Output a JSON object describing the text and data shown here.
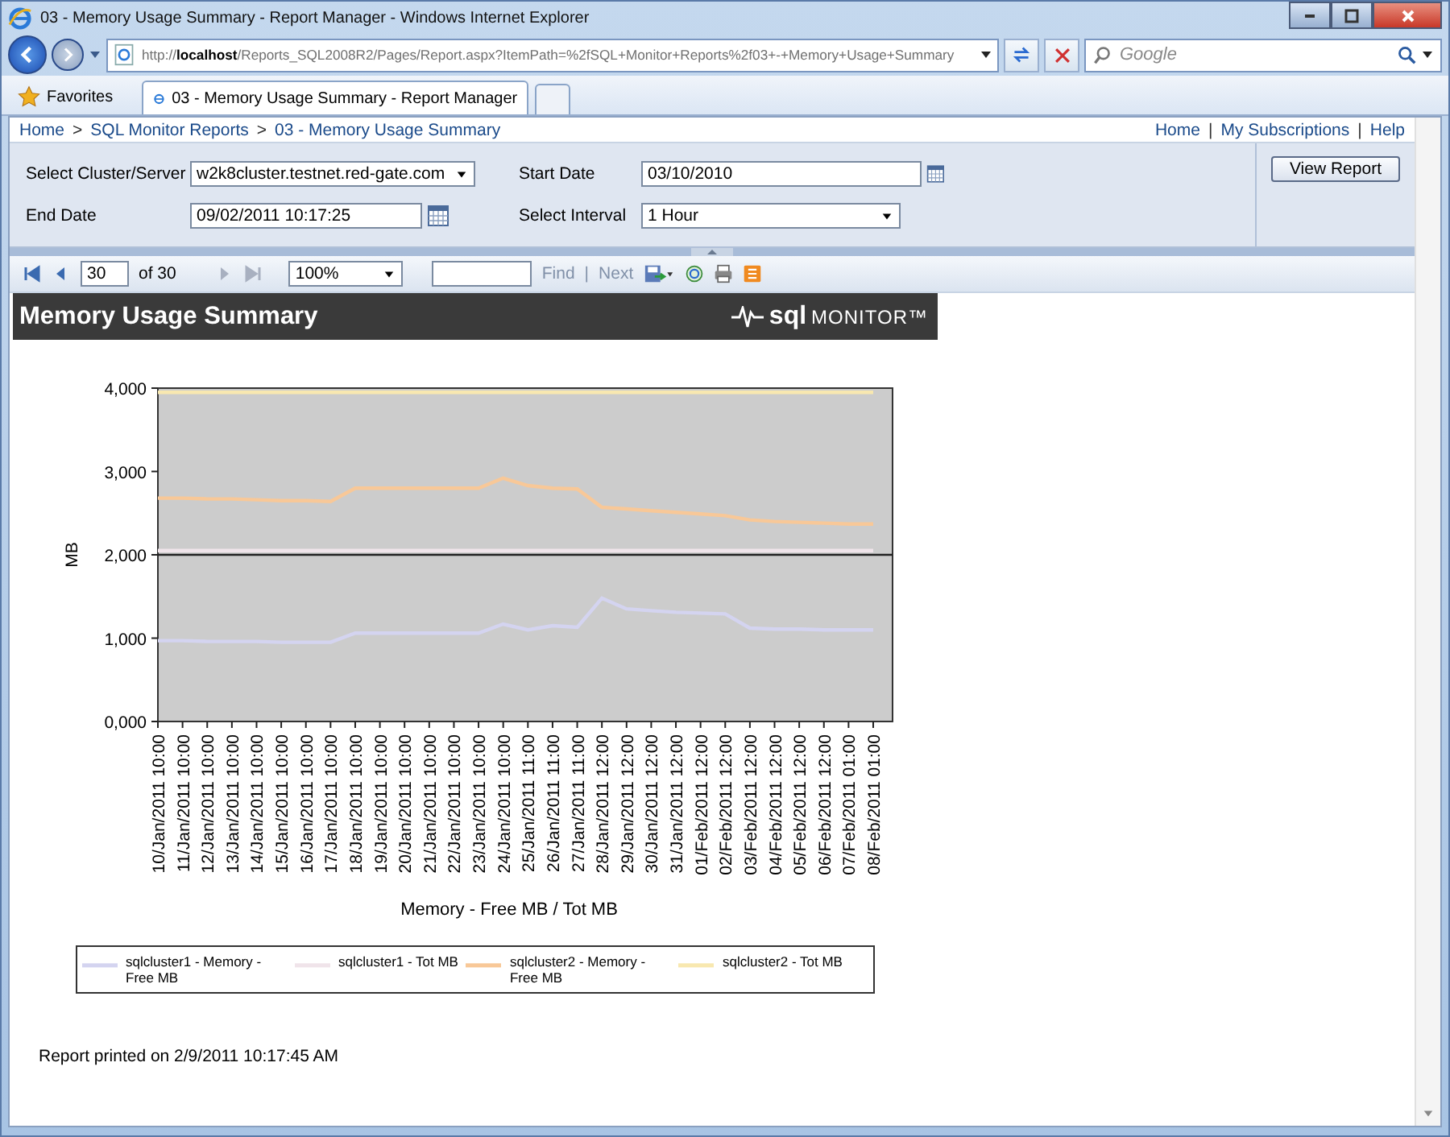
{
  "window": {
    "title": "03 - Memory Usage Summary - Report Manager - Windows Internet Explorer"
  },
  "address_bar": {
    "url": "http://**localhost**/Reports_SQL2008R2/Pages/Report.aspx?ItemPath=%2fSQL+Monitor+Reports%2f03+-+Memory+Usage+Summary",
    "search_placeholder": "Google"
  },
  "favorites": "Favorites",
  "tabs": [
    {
      "label": "03 - Memory Usage Summary - Report Manager",
      "selected": true
    }
  ],
  "breadcrumb": {
    "items": [
      "Home",
      "SQL Monitor Reports",
      "03 - Memory Usage Summary"
    ],
    "separator": ">"
  },
  "top_links": {
    "items": [
      "Home",
      "My Subscriptions",
      "Help"
    ],
    "separator": "|"
  },
  "parameters": [
    {
      "label": "Select Cluster/Server",
      "value": "w2k8cluster.testnet.red-gate.com",
      "kind": "dropdown"
    },
    {
      "label": "Start Date",
      "value": "03/10/2010",
      "kind": "date"
    },
    {
      "label": "End Date",
      "value": "09/02/2011 10:17:25",
      "kind": "date"
    },
    {
      "label": "Select Interval",
      "value": "1 Hour",
      "kind": "dropdown"
    }
  ],
  "view_report_button": "View Report",
  "toolbar": {
    "page": "30",
    "page_count": "of 30",
    "zoom": "100%",
    "find": "Find",
    "separator": "|",
    "next": "Next"
  },
  "report": {
    "title": "Memory Usage Summary",
    "logo_bold": "sql",
    "logo_text": "MONITOR™",
    "chart_data": {
      "type": "line",
      "legend": "bottom",
      "xlabel": "Memory - Free MB / Tot MB",
      "ylabel": "MB",
      "ylim": [
        0,
        4000
      ],
      "yticks": [
        {
          "value": 0,
          "label": "0,000"
        },
        {
          "value": 1000,
          "label": "1,000"
        },
        {
          "value": 2000,
          "label": "2,000"
        },
        {
          "value": 3000,
          "label": "3,000"
        },
        {
          "value": 4000,
          "label": "4,000"
        }
      ],
      "categories": [
        "10/Jan/2011 10:00",
        "11/Jan/2011 10:00",
        "12/Jan/2011 10:00",
        "13/Jan/2011 10:00",
        "14/Jan/2011 10:00",
        "15/Jan/2011 10:00",
        "16/Jan/2011 10:00",
        "17/Jan/2011 10:00",
        "18/Jan/2011 10:00",
        "19/Jan/2011 10:00",
        "20/Jan/2011 10:00",
        "21/Jan/2011 10:00",
        "22/Jan/2011 10:00",
        "23/Jan/2011 10:00",
        "24/Jan/2011 10:00",
        "25/Jan/2011 11:00",
        "26/Jan/2011 11:00",
        "27/Jan/2011 11:00",
        "28/Jan/2011 12:00",
        "29/Jan/2011 12:00",
        "30/Jan/2011 12:00",
        "31/Jan/2011 12:00",
        "01/Feb/2011 12:00",
        "02/Feb/2011 12:00",
        "03/Feb/2011 12:00",
        "04/Feb/2011 12:00",
        "05/Feb/2011 12:00",
        "06/Feb/2011 12:00",
        "07/Feb/2011 01:00",
        "08/Feb/2011 01:00"
      ],
      "series": [
        {
          "name": "sqlcluster1 - Memory - Free MB",
          "color": "#d4d4f0",
          "values": [
            970,
            970,
            960,
            960,
            960,
            950,
            950,
            950,
            1060,
            1060,
            1060,
            1060,
            1060,
            1060,
            1170,
            1100,
            1150,
            1130,
            1480,
            1350,
            1330,
            1310,
            1300,
            1290,
            1120,
            1110,
            1110,
            1100,
            1100,
            1100
          ]
        },
        {
          "name": "sqlcluster1 - Tot MB",
          "color": "#f0e4ea",
          "values": [
            2050,
            2050,
            2050,
            2050,
            2050,
            2050,
            2050,
            2050,
            2050,
            2050,
            2050,
            2050,
            2050,
            2050,
            2050,
            2050,
            2050,
            2050,
            2050,
            2050,
            2050,
            2050,
            2050,
            2050,
            2050,
            2050,
            2050,
            2050,
            2050,
            2050
          ]
        },
        {
          "name": "sqlcluster2 - Memory - Free MB",
          "color": "#f8c898",
          "values": [
            2680,
            2680,
            2670,
            2670,
            2660,
            2650,
            2650,
            2640,
            2800,
            2800,
            2800,
            2800,
            2800,
            2800,
            2920,
            2830,
            2800,
            2790,
            2570,
            2550,
            2530,
            2510,
            2490,
            2470,
            2420,
            2400,
            2390,
            2380,
            2370,
            2370
          ]
        },
        {
          "name": "sqlcluster2 - Tot MB",
          "color": "#f8e8b0",
          "values": [
            3950,
            3950,
            3950,
            3950,
            3950,
            3950,
            3950,
            3950,
            3950,
            3950,
            3950,
            3950,
            3950,
            3950,
            3950,
            3950,
            3950,
            3950,
            3950,
            3950,
            3950,
            3950,
            3950,
            3950,
            3950,
            3950,
            3950,
            3950,
            3950,
            3950
          ]
        }
      ]
    },
    "footer": "Report printed on 2/9/2011 10:17:45 AM"
  }
}
